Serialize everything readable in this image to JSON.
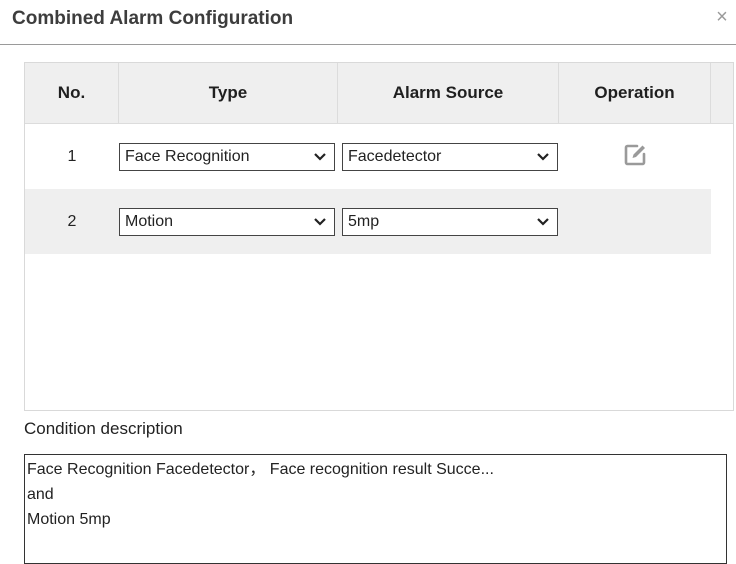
{
  "dialog": {
    "title": "Combined Alarm Configuration",
    "close_glyph": "×"
  },
  "table": {
    "headers": {
      "no": "No.",
      "type": "Type",
      "source": "Alarm Source",
      "operation": "Operation"
    },
    "rows": [
      {
        "no": "1",
        "type": "Face Recognition",
        "source": "Facedetector",
        "has_edit": true
      },
      {
        "no": "2",
        "type": "Motion",
        "source": "5mp",
        "has_edit": false
      }
    ]
  },
  "condition": {
    "label": "Condition description",
    "lines": [
      "Face Recognition Facedetector， Face recognition result Succe...",
      "and",
      "Motion 5mp"
    ]
  },
  "icons": {
    "close": "close-icon",
    "edit": "edit-icon",
    "dropdown": "chevron-down-icon"
  },
  "colors": {
    "header_bg": "#efefef",
    "alt_row_bg": "#efefef",
    "title": "#3d3d3d",
    "icon_gray": "#9a9a9a"
  }
}
